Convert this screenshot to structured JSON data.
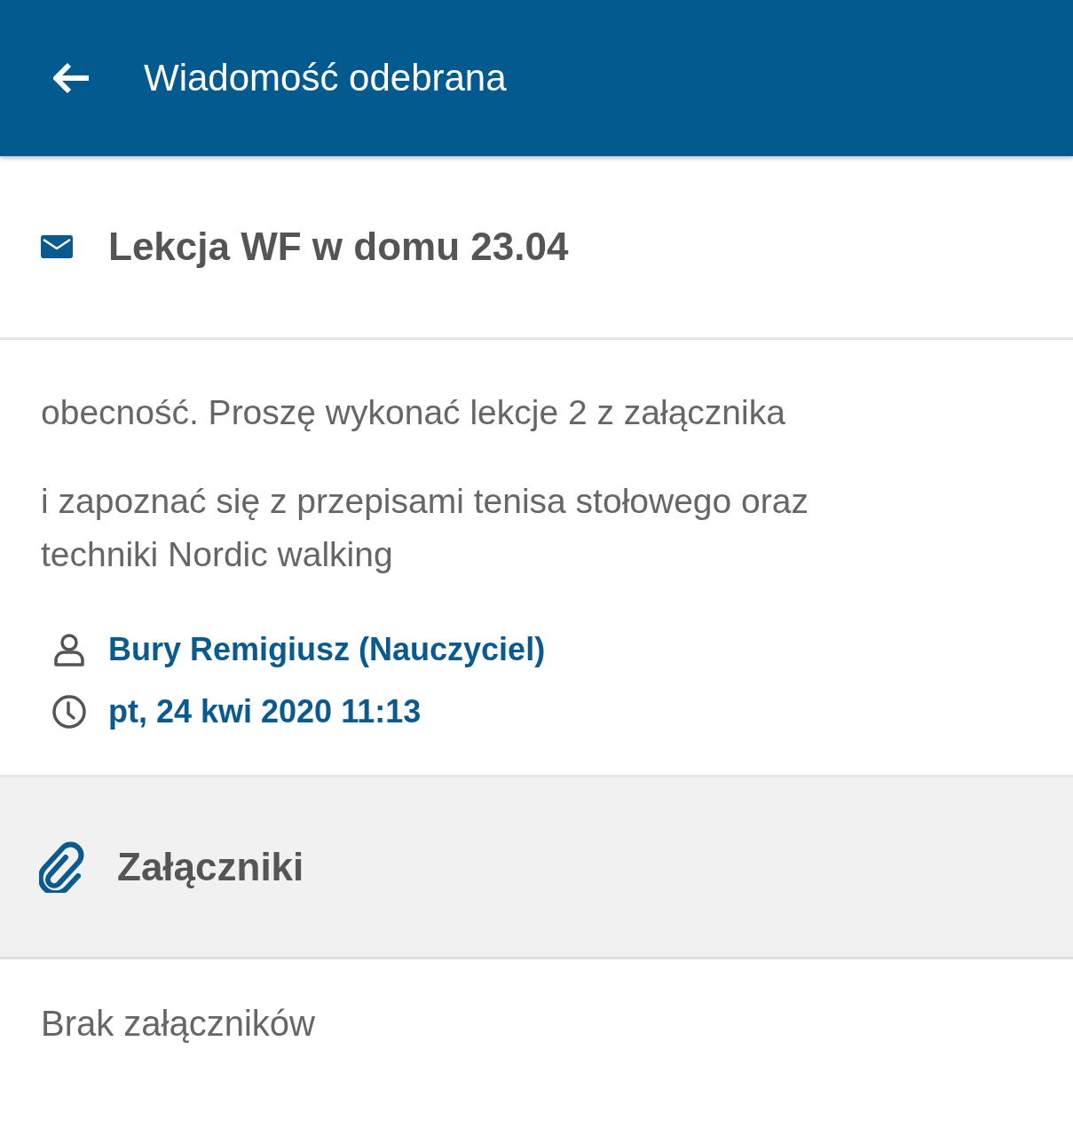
{
  "header": {
    "title": "Wiadomość odebrana"
  },
  "message": {
    "subject": "Lekcja WF w domu 23.04",
    "paragraphs": [
      "obecność. Proszę wykonać lekcje 2 z załącznika",
      "i zapoznać się z przepisami tenisa stołowego oraz techniki Nordic walking"
    ],
    "sender": "Bury Remigiusz (Nauczyciel)",
    "date": "pt, 24 kwi 2020 11:13"
  },
  "attachments": {
    "title": "Załączniki",
    "empty_text": "Brak załączników"
  }
}
